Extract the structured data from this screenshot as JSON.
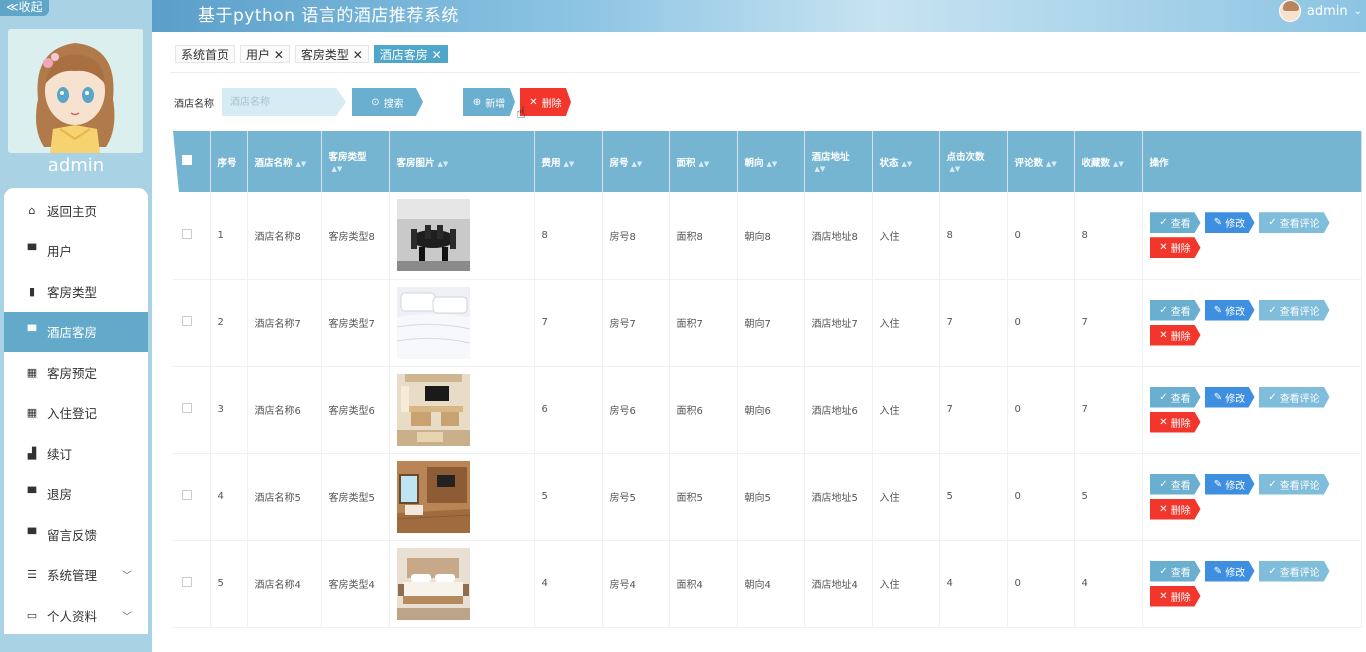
{
  "header": {
    "title": "基于python 语言的酒店推荐系统",
    "username": "admin"
  },
  "sidebar": {
    "collapse_label": "≪收起",
    "profile_name": "admin",
    "items": [
      {
        "label": "返回主页",
        "icon": "home-icon"
      },
      {
        "label": "用户",
        "icon": "monitor-icon"
      },
      {
        "label": "客房类型",
        "icon": "document-icon"
      },
      {
        "label": "酒店客房",
        "icon": "monitor-icon"
      },
      {
        "label": "客房预定",
        "icon": "grid-icon"
      },
      {
        "label": "入住登记",
        "icon": "grid-icon"
      },
      {
        "label": "续订",
        "icon": "thumb-icon"
      },
      {
        "label": "退房",
        "icon": "monitor-icon"
      },
      {
        "label": "留言反馈",
        "icon": "monitor-icon"
      },
      {
        "label": "系统管理",
        "icon": "settings-icon"
      },
      {
        "label": "个人资料",
        "icon": "card-icon"
      }
    ]
  },
  "tabs": [
    {
      "label": "系统首页"
    },
    {
      "label": "用户 ✕"
    },
    {
      "label": "客房类型 ✕"
    },
    {
      "label": "酒店客房 ✕"
    }
  ],
  "search": {
    "label": "酒店名称",
    "placeholder": "酒店名称",
    "search_btn": "搜索",
    "add_btn": "新增",
    "delete_btn": "删除"
  },
  "table": {
    "headers": [
      "序号",
      "酒店名称",
      "客房类型",
      "客房图片",
      "费用",
      "房号",
      "面积",
      "朝向",
      "酒店地址",
      "状态",
      "点击次数",
      "评论数",
      "收藏数",
      "操作"
    ],
    "actions": {
      "view": "查看",
      "edit": "修改",
      "comment": "查看评论",
      "remove": "删除"
    },
    "rows": [
      {
        "idx": "1",
        "name": "酒店名称8",
        "type": "客房类型8",
        "fee": "8",
        "room": "房号8",
        "area": "面积8",
        "facing": "朝向8",
        "addr": "酒店地址8",
        "status": "入住",
        "clicks": "8",
        "comments": "0",
        "favs": "8"
      },
      {
        "idx": "2",
        "name": "酒店名称7",
        "type": "客房类型7",
        "fee": "7",
        "room": "房号7",
        "area": "面积7",
        "facing": "朝向7",
        "addr": "酒店地址7",
        "status": "入住",
        "clicks": "7",
        "comments": "0",
        "favs": "7"
      },
      {
        "idx": "3",
        "name": "酒店名称6",
        "type": "客房类型6",
        "fee": "6",
        "room": "房号6",
        "area": "面积6",
        "facing": "朝向6",
        "addr": "酒店地址6",
        "status": "入住",
        "clicks": "7",
        "comments": "0",
        "favs": "7"
      },
      {
        "idx": "4",
        "name": "酒店名称5",
        "type": "客房类型5",
        "fee": "5",
        "room": "房号5",
        "area": "面积5",
        "facing": "朝向5",
        "addr": "酒店地址5",
        "status": "入住",
        "clicks": "5",
        "comments": "0",
        "favs": "5"
      },
      {
        "idx": "5",
        "name": "酒店名称4",
        "type": "客房类型4",
        "fee": "4",
        "room": "房号4",
        "area": "面积4",
        "facing": "朝向4",
        "addr": "酒店地址4",
        "status": "入住",
        "clicks": "4",
        "comments": "0",
        "favs": "4"
      }
    ]
  },
  "colors": {
    "accent": "#62a9ca",
    "danger": "#f2362b",
    "edit": "#3e8fe0"
  }
}
